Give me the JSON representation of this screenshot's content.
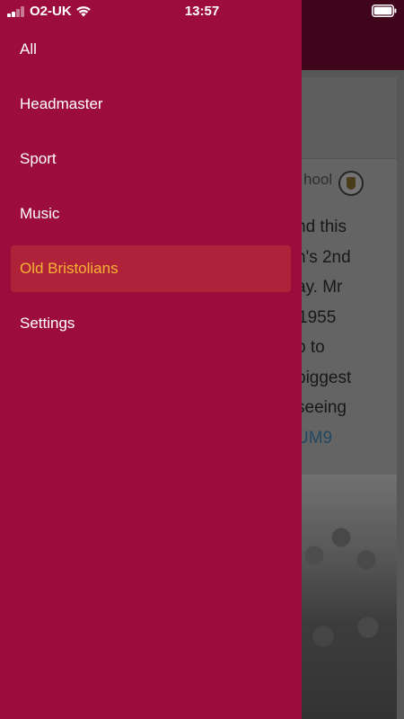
{
  "status_bar": {
    "carrier": "O2-UK",
    "time": "13:57"
  },
  "drawer": {
    "items": [
      {
        "label": "All",
        "active": false
      },
      {
        "label": "Headmaster",
        "active": false
      },
      {
        "label": "Sport",
        "active": false
      },
      {
        "label": "Music",
        "active": false
      },
      {
        "label": "Old Bristolians",
        "active": true
      },
      {
        "label": "Settings",
        "active": false
      }
    ]
  },
  "background": {
    "source_partial": "hool",
    "text_lines": [
      "nd this",
      "h's 2nd",
      "ay. Mr",
      "1955",
      "p to",
      "biggest",
      "seeing"
    ],
    "link_partial": "UM9"
  },
  "colors": {
    "drawer_bg": "#9c0c3d",
    "active_item_bg": "#b0213a",
    "active_item_text": "#f6b334",
    "header_bg": "#4e0722"
  }
}
